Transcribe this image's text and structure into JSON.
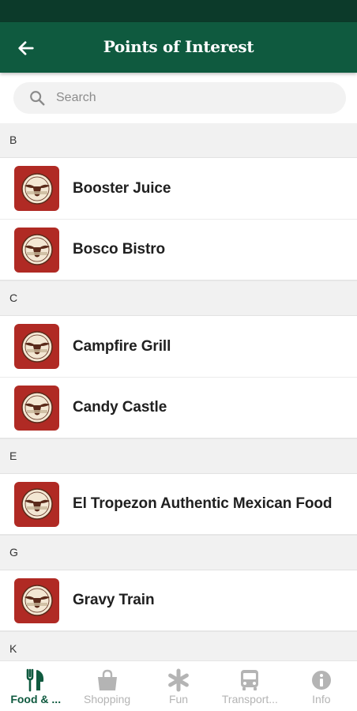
{
  "header": {
    "title": "Points of Interest"
  },
  "search": {
    "placeholder": "Search"
  },
  "sections": [
    {
      "letter": "B",
      "items": [
        "Booster Juice",
        "Bosco Bistro"
      ]
    },
    {
      "letter": "C",
      "items": [
        "Campfire Grill",
        "Candy Castle"
      ]
    },
    {
      "letter": "E",
      "items": [
        "El Tropezon Authentic Mexican Food"
      ]
    },
    {
      "letter": "G",
      "items": [
        "Gravy Train"
      ]
    },
    {
      "letter": "K",
      "items": []
    }
  ],
  "bottom_nav": [
    {
      "label": "Food & ...",
      "icon": "fork-knife-icon",
      "active": true
    },
    {
      "label": "Shopping",
      "icon": "shopping-bag-icon",
      "active": false
    },
    {
      "label": "Fun",
      "icon": "asterisk-icon",
      "active": false
    },
    {
      "label": "Transport...",
      "icon": "bus-icon",
      "active": false
    },
    {
      "label": "Info",
      "icon": "info-icon",
      "active": false
    }
  ],
  "colors": {
    "header_bg": "#0f5a3f",
    "status_bar": "#0c3a2a",
    "logo_bg": "#b02a24",
    "active_nav": "#0f5a3f",
    "inactive_nav": "#b4b4b4"
  }
}
